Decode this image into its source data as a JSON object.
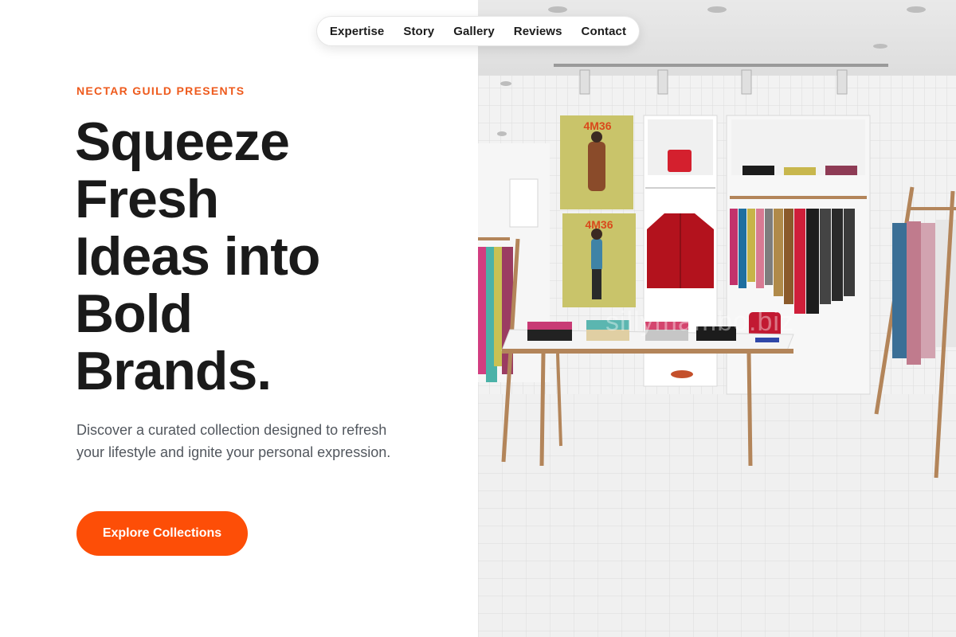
{
  "nav": {
    "items": [
      {
        "label": "Expertise"
      },
      {
        "label": "Story"
      },
      {
        "label": "Gallery"
      },
      {
        "label": "Reviews"
      },
      {
        "label": "Contact"
      }
    ]
  },
  "hero": {
    "eyebrow": "NECTAR GUILD PRESENTS",
    "headline_lines": [
      "Squeeze",
      "Fresh",
      "Ideas into",
      "Bold",
      "Brands."
    ],
    "description": "Discover a curated collection designed to refresh your lifestyle and ignite your personal expression.",
    "cta_label": "Explore Collections"
  },
  "image": {
    "poster_label_top": "4M36",
    "poster_label_bottom": "4M36",
    "watermark": "sillymambo.biz"
  },
  "colors": {
    "accent": "#fd4e07",
    "eyebrow": "#ee5a1c",
    "headline": "#1a1a1a",
    "body_text": "#52575e"
  }
}
